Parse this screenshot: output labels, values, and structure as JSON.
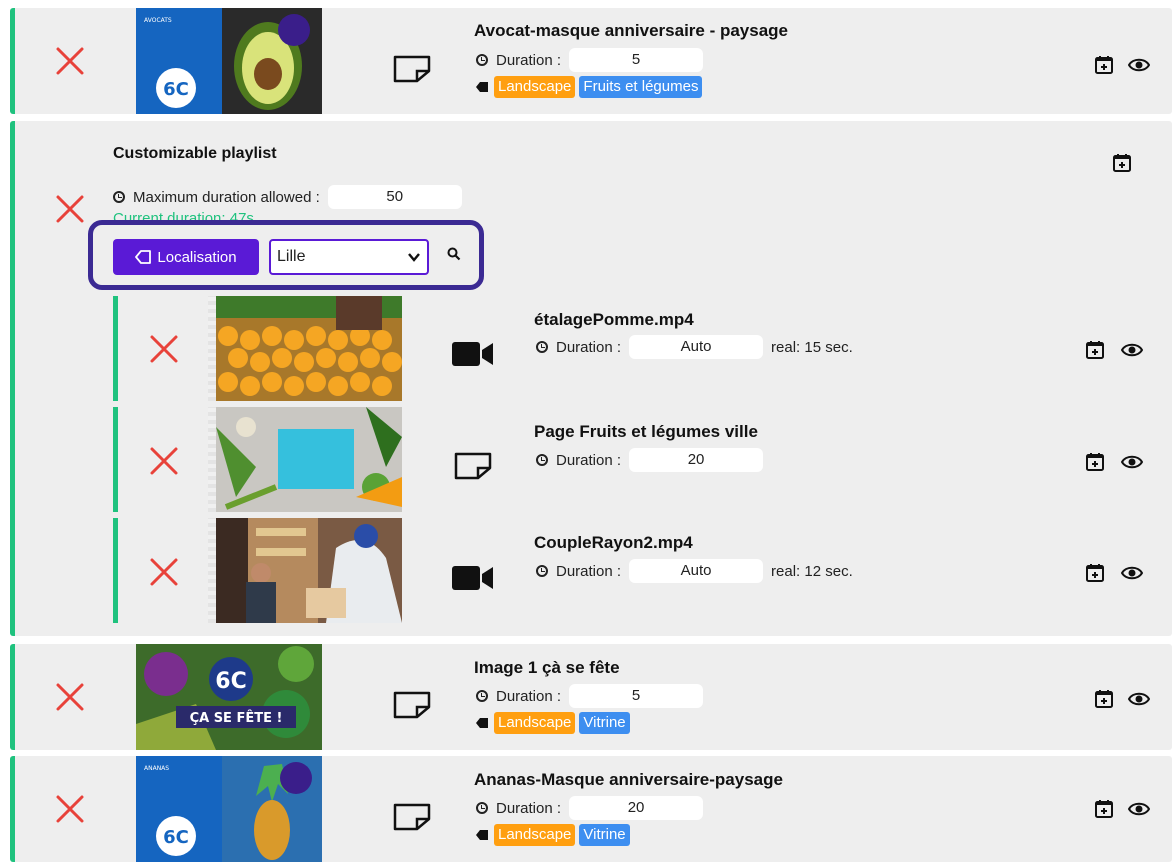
{
  "items": [
    {
      "title": "Avocat-masque anniversaire - paysage",
      "duration_label": "Duration :",
      "duration_value": "5",
      "tags": [
        "Landscape",
        "Fruits et légumes"
      ],
      "type_icon": "page-icon",
      "thumb_overlay_text": "6C",
      "thumb_small_text": "AVOCATS"
    },
    {
      "title": "Image 1 çà se fête",
      "duration_label": "Duration :",
      "duration_value": "5",
      "tags": [
        "Landscape",
        "Vitrine"
      ],
      "type_icon": "page-icon",
      "thumb_overlay_text": "6C",
      "thumb_caption": "ÇA SE FÊTE !"
    },
    {
      "title": "Ananas-Masque anniversaire-paysage",
      "duration_label": "Duration :",
      "duration_value": "20",
      "tags": [
        "Landscape",
        "Vitrine"
      ],
      "type_icon": "page-icon",
      "thumb_overlay_text": "6C",
      "thumb_small_text": "ANANAS"
    }
  ],
  "playlist": {
    "title": "Customizable playlist",
    "max_duration_label": "Maximum duration allowed :",
    "max_duration_value": "50",
    "current_duration_text": "Current duration: 47s",
    "filter": {
      "button_label": "Localisation",
      "selected_value": "Lille"
    },
    "sub_items": [
      {
        "title": "étalagePomme.mp4",
        "duration_label": "Duration :",
        "duration_value": "Auto",
        "real_text": "real: 15 sec.",
        "type_icon": "video-icon"
      },
      {
        "title": "Page Fruits et légumes ville",
        "duration_label": "Duration :",
        "duration_value": "20",
        "real_text": "",
        "type_icon": "page-icon"
      },
      {
        "title": "CoupleRayon2.mp4",
        "duration_label": "Duration :",
        "duration_value": "Auto",
        "real_text": "real: 12 sec.",
        "type_icon": "video-icon"
      }
    ]
  },
  "colors": {
    "accent_green": "#1fc27e",
    "delete_red": "#e8423a",
    "tag_orange": "#ff9f10",
    "tag_blue": "#3d8ef0",
    "filter_purple": "#5a1ad6",
    "highlight_border": "#3b2a93"
  }
}
